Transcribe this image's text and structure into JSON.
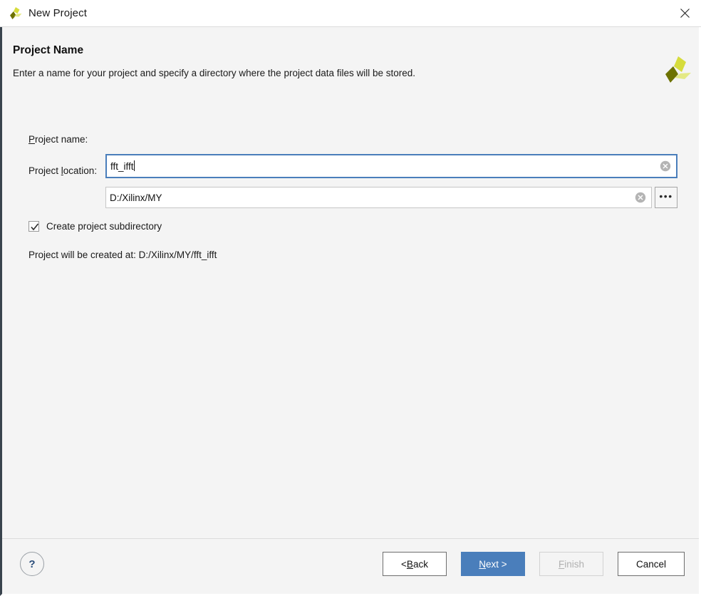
{
  "titlebar": {
    "title": "New Project",
    "logo_icon": "vivado-logo-icon",
    "close_icon": "close-icon"
  },
  "header": {
    "title": "Project Name",
    "subtitle": "Enter a name for your project and specify a directory where the project data files will be stored.",
    "logo_icon": "vivado-logo-icon"
  },
  "form": {
    "project_name": {
      "label_prefix": "",
      "label": "Project name:",
      "value": "fft_ifft",
      "placeholder": "",
      "clear_icon": "clear-circle-icon"
    },
    "project_location": {
      "label": "Project location:",
      "value": "D:/Xilinx/MY",
      "placeholder": "",
      "clear_icon": "clear-circle-icon",
      "browse_label": "•••"
    },
    "create_subdirectory": {
      "label": "Create project subdirectory",
      "checked": true,
      "check_icon": "checkmark-icon"
    },
    "created_at": "Project will be created at: D:/Xilinx/MY/fft_ifft"
  },
  "footer": {
    "help_label": "?",
    "help_icon": "question-mark-icon",
    "back_label": "< Back",
    "next_label": "Next >",
    "finish_label": "Finish",
    "cancel_label": "Cancel"
  },
  "colors": {
    "accent_blue": "#4a7ebb",
    "logo_bright": "#d6dc3c",
    "logo_dark": "#6d7200",
    "logo_pale": "#e4e985",
    "frame_border": "#39434d",
    "panel_bg": "#f4f4f4"
  }
}
